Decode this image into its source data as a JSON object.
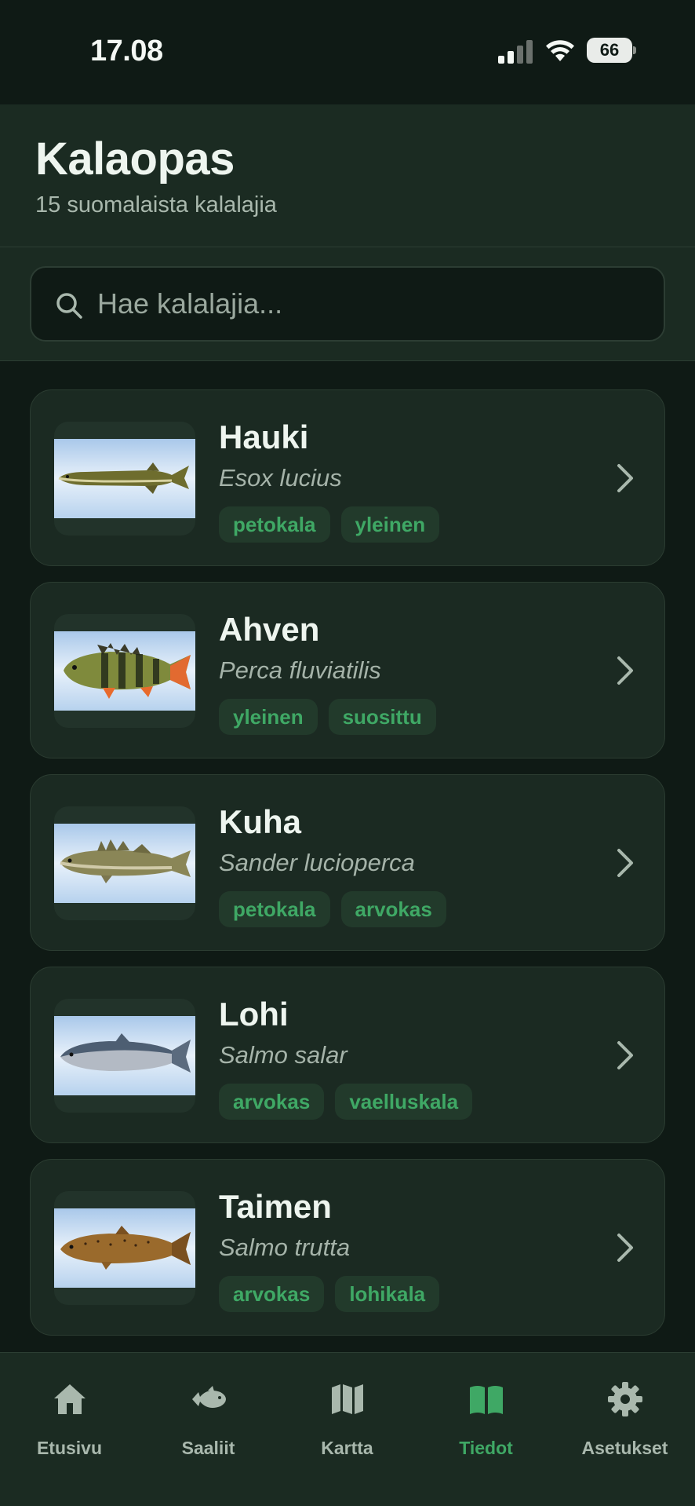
{
  "status_bar": {
    "time": "17.08",
    "battery": "66"
  },
  "header": {
    "title": "Kalaopas",
    "subtitle": "15 suomalaista kalalajia"
  },
  "search": {
    "placeholder": "Hae kalalajia..."
  },
  "fish": [
    {
      "name": "Hauki",
      "latin": "Esox lucius",
      "tags": [
        "petokala",
        "yleinen"
      ],
      "image": "pike-image"
    },
    {
      "name": "Ahven",
      "latin": "Perca fluviatilis",
      "tags": [
        "yleinen",
        "suosittu"
      ],
      "image": "perch-image"
    },
    {
      "name": "Kuha",
      "latin": "Sander lucioperca",
      "tags": [
        "petokala",
        "arvokas"
      ],
      "image": "zander-image"
    },
    {
      "name": "Lohi",
      "latin": "Salmo salar",
      "tags": [
        "arvokas",
        "vaelluskala"
      ],
      "image": "salmon-image"
    },
    {
      "name": "Taimen",
      "latin": "Salmo trutta",
      "tags": [
        "arvokas",
        "lohikala"
      ],
      "image": "trout-image"
    }
  ],
  "nav": [
    {
      "label": "Etusivu",
      "icon": "home-icon",
      "active": false
    },
    {
      "label": "Saaliit",
      "icon": "fish-icon",
      "active": false
    },
    {
      "label": "Kartta",
      "icon": "map-icon",
      "active": false
    },
    {
      "label": "Tiedot",
      "icon": "book-icon",
      "active": true
    },
    {
      "label": "Asetukset",
      "icon": "gear-icon",
      "active": false
    }
  ],
  "colors": {
    "background": "#0f1a15",
    "surface": "#1b2b22",
    "accent": "#3fa865",
    "text": "#eef5ef",
    "muted": "#a9b8ad"
  }
}
